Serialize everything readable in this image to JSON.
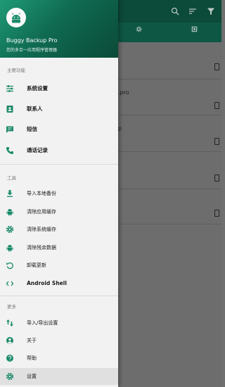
{
  "app": {
    "name": "Buggy Backup Pro",
    "subtitle": "您的多合一应用程序管理器"
  },
  "colors": {
    "accent": "#1a8a6a",
    "header_dark": "#0b4a38",
    "drawer_bg": "#f2f2f2"
  },
  "background": {
    "row_text_1": ".pro",
    "row_text_2": "p"
  },
  "drawer": {
    "sections": {
      "main": "主要功能",
      "tools": "工具",
      "more": "更多"
    },
    "main_items": [
      {
        "label": "系统设置",
        "icon": "sliders-icon"
      },
      {
        "label": "联系人",
        "icon": "contacts-icon"
      },
      {
        "label": "短信",
        "icon": "message-icon"
      },
      {
        "label": "通话记录",
        "icon": "phone-icon"
      }
    ],
    "tool_items": [
      {
        "label": "导入本地备份",
        "icon": "download-icon"
      },
      {
        "label": "清除应用缓存",
        "icon": "android-icon"
      },
      {
        "label": "清除系统缓存",
        "icon": "gear-icon"
      },
      {
        "label": "清除残余数据",
        "icon": "android-icon"
      },
      {
        "label": "卸载更新",
        "icon": "restore-icon"
      },
      {
        "label": "Android Shell",
        "icon": "code-icon"
      }
    ],
    "more_items": [
      {
        "label": "导入/导出设置",
        "icon": "swap-vertical-icon"
      },
      {
        "label": "关于",
        "icon": "account-circle-icon"
      },
      {
        "label": "帮助",
        "icon": "help-icon"
      },
      {
        "label": "设置",
        "icon": "settings-icon"
      }
    ]
  }
}
